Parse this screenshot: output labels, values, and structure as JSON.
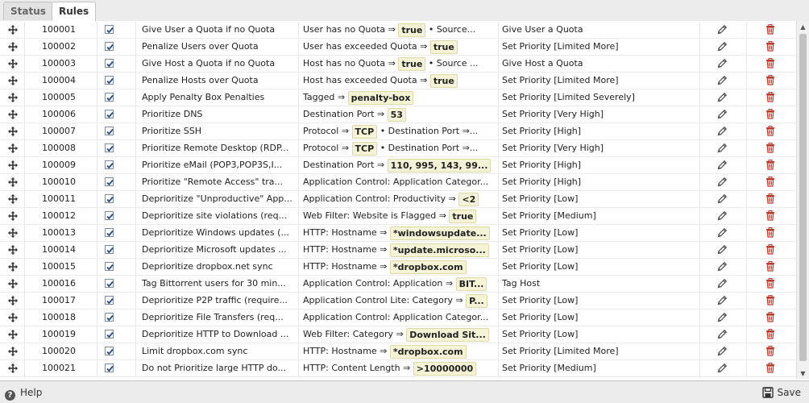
{
  "tabs": [
    {
      "label": "Status",
      "active": false
    },
    {
      "label": "Rules",
      "active": true
    }
  ],
  "rules": [
    {
      "id": "100001",
      "enabled": true,
      "description": "Give User a Quota if no Quota",
      "conditions": [
        {
          "text": "User has no Quota ⇒",
          "value": "true"
        },
        {
          "text": "•  Source...",
          "value": null
        }
      ],
      "action": "Give User a Quota"
    },
    {
      "id": "100002",
      "enabled": true,
      "description": "Penalize Users over Quota",
      "conditions": [
        {
          "text": "User has exceeded Quota ⇒",
          "value": "true"
        }
      ],
      "action": "Set Priority [Limited More]"
    },
    {
      "id": "100003",
      "enabled": true,
      "description": "Give Host a Quota if no Quota",
      "conditions": [
        {
          "text": "Host has no Quota ⇒",
          "value": "true"
        },
        {
          "text": "•  Source ...",
          "value": null
        }
      ],
      "action": "Give Host a Quota"
    },
    {
      "id": "100004",
      "enabled": true,
      "description": "Penalize Hosts over Quota",
      "conditions": [
        {
          "text": "Host has exceeded Quota ⇒",
          "value": "true"
        }
      ],
      "action": "Set Priority [Limited More]"
    },
    {
      "id": "100005",
      "enabled": true,
      "description": "Apply Penalty Box Penalties",
      "conditions": [
        {
          "text": "Tagged ⇒",
          "value": "penalty-box"
        }
      ],
      "action": "Set Priority [Limited Severely]"
    },
    {
      "id": "100006",
      "enabled": true,
      "description": "Prioritize DNS",
      "conditions": [
        {
          "text": "Destination Port ⇒",
          "value": "53"
        }
      ],
      "action": "Set Priority [Very High]"
    },
    {
      "id": "100007",
      "enabled": true,
      "description": "Prioritize SSH",
      "conditions": [
        {
          "text": "Protocol ⇒",
          "value": "TCP"
        },
        {
          "text": "•  Destination Port ⇒...",
          "value": null
        }
      ],
      "action": "Set Priority [High]"
    },
    {
      "id": "100008",
      "enabled": true,
      "description": "Prioritize Remote Desktop (RDP...",
      "conditions": [
        {
          "text": "Protocol ⇒",
          "value": "TCP"
        },
        {
          "text": "•  Destination Port ⇒...",
          "value": null
        }
      ],
      "action": "Set Priority [Very High]"
    },
    {
      "id": "100009",
      "enabled": true,
      "description": "Prioritize eMail (POP3,POP3S,I...",
      "conditions": [
        {
          "text": "Destination Port ⇒",
          "value": "110, 995, 143, 99..."
        }
      ],
      "action": "Set Priority [High]"
    },
    {
      "id": "100010",
      "enabled": true,
      "description": "Prioritize \"Remote Access\" tra...",
      "conditions": [
        {
          "text": "Application Control: Application Categor...",
          "value": null
        }
      ],
      "action": "Set Priority [High]"
    },
    {
      "id": "100011",
      "enabled": true,
      "description": "Deprioritize \"Unproductive\" App...",
      "conditions": [
        {
          "text": "Application Control: Productivity ⇒",
          "value": "<2"
        }
      ],
      "action": "Set Priority [Low]"
    },
    {
      "id": "100012",
      "enabled": true,
      "description": "Deprioritize site violations (req...",
      "conditions": [
        {
          "text": "Web Filter: Website is Flagged ⇒",
          "value": "true"
        }
      ],
      "action": "Set Priority [Medium]"
    },
    {
      "id": "100013",
      "enabled": true,
      "description": "Deprioritize Windows updates (...",
      "conditions": [
        {
          "text": "HTTP: Hostname ⇒",
          "value": "*windowsupdate..."
        }
      ],
      "action": "Set Priority [Low]"
    },
    {
      "id": "100014",
      "enabled": true,
      "description": "Deprioritize Microsoft updates ...",
      "conditions": [
        {
          "text": "HTTP: Hostname ⇒",
          "value": "*update.microso..."
        }
      ],
      "action": "Set Priority [Low]"
    },
    {
      "id": "100015",
      "enabled": true,
      "description": "Deprioritize dropbox.net sync",
      "conditions": [
        {
          "text": "HTTP: Hostname ⇒",
          "value": "*dropbox.com"
        }
      ],
      "action": "Set Priority [Low]"
    },
    {
      "id": "100016",
      "enabled": true,
      "description": "Tag Bittorrent users for 30 min...",
      "conditions": [
        {
          "text": "Application Control: Application ⇒",
          "value": "BIT..."
        }
      ],
      "action": "Tag Host"
    },
    {
      "id": "100017",
      "enabled": true,
      "description": "Deprioritize P2P traffic (require...",
      "conditions": [
        {
          "text": "Application Control Lite: Category ⇒",
          "value": "P..."
        }
      ],
      "action": "Set Priority [Low]"
    },
    {
      "id": "100018",
      "enabled": true,
      "description": "Deprioritize File Transfers (req...",
      "conditions": [
        {
          "text": "Application Control: Application Categor...",
          "value": null
        }
      ],
      "action": "Set Priority [Low]"
    },
    {
      "id": "100019",
      "enabled": true,
      "description": "Deprioritize HTTP to Download ...",
      "conditions": [
        {
          "text": "Web Filter: Category ⇒",
          "value": "Download Sit..."
        }
      ],
      "action": "Set Priority [Low]"
    },
    {
      "id": "100020",
      "enabled": true,
      "description": "Limit dropbox.com sync",
      "conditions": [
        {
          "text": "HTTP: Hostname ⇒",
          "value": "*dropbox.com"
        }
      ],
      "action": "Set Priority [Limited More]"
    },
    {
      "id": "100021",
      "enabled": true,
      "description": "Do not Prioritize large HTTP do...",
      "conditions": [
        {
          "text": "HTTP: Content Length ⇒",
          "value": ">10000000"
        }
      ],
      "action": "Set Priority [Medium]"
    }
  ],
  "footer": {
    "help_label": "Help",
    "save_label": "Save"
  },
  "icons": {
    "drag": "move-icon",
    "edit": "pencil-icon",
    "delete": "trash-icon",
    "help": "help-icon",
    "save": "save-icon"
  },
  "colors": {
    "delete_icon": "#c0392b",
    "value_highlight": "#f5f3d6",
    "checkbox_check": "#2a4a8a"
  }
}
